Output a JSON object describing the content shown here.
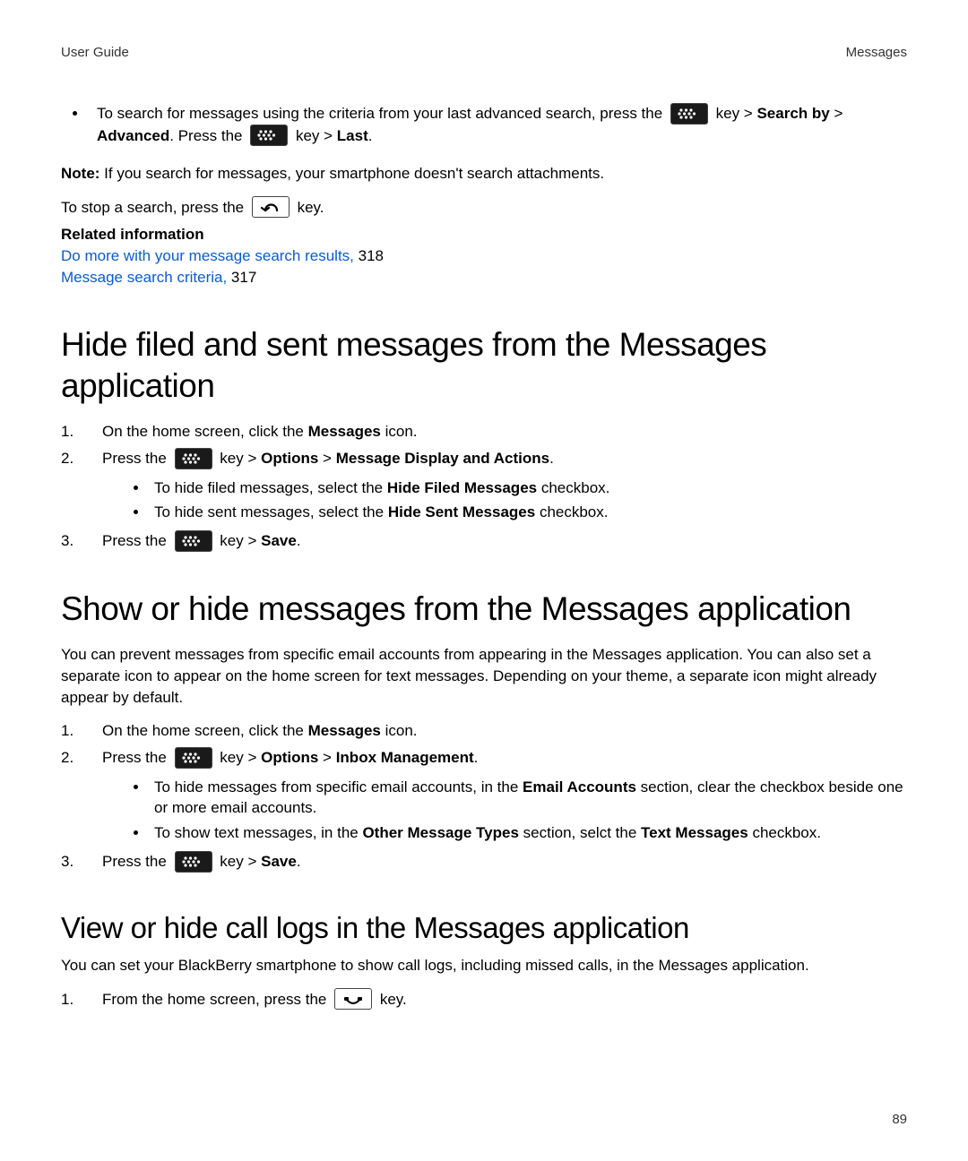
{
  "header": {
    "left": "User Guide",
    "right": "Messages"
  },
  "top_bullet": {
    "t1": "To search for messages using the criteria from your last advanced search, press the ",
    "t2": " key > ",
    "t3": "Search by",
    "t4": " > ",
    "t5": "Advanced",
    "t6": ". Press the ",
    "t7": " key > ",
    "t8": "Last",
    "t9": "."
  },
  "note": {
    "label": "Note:",
    "text": " If you search for messages, your smartphone doesn't search attachments."
  },
  "stop_line": {
    "t1": "To stop a search, press the ",
    "t2": " key."
  },
  "related": {
    "heading": "Related information",
    "items": [
      {
        "link": "Do more with your message search results,",
        "page": " 318"
      },
      {
        "link": "Message search criteria,",
        "page": " 317"
      }
    ]
  },
  "section_a": {
    "title": "Hide filed and sent messages from the Messages application",
    "step1": {
      "t1": "On the home screen, click the ",
      "t2": "Messages",
      "t3": " icon."
    },
    "step2": {
      "t1": "Press the ",
      "t2": " key > ",
      "t3": "Options",
      "t4": " > ",
      "t5": "Message Display and Actions",
      "t6": "."
    },
    "sub1": {
      "t1": "To hide filed messages, select the ",
      "t2": "Hide Filed Messages",
      "t3": " checkbox."
    },
    "sub2": {
      "t1": "To hide sent messages, select the ",
      "t2": "Hide Sent Messages",
      "t3": " checkbox."
    },
    "step3": {
      "t1": "Press the ",
      "t2": " key > ",
      "t3": "Save",
      "t4": "."
    }
  },
  "section_b": {
    "title": "Show or hide messages from the Messages application",
    "intro": "You can prevent messages from specific email accounts from appearing in the Messages application. You can also set a separate icon to appear on the home screen for text messages. Depending on your theme, a separate icon might already appear by default.",
    "step1": {
      "t1": "On the home screen, click the ",
      "t2": "Messages",
      "t3": " icon."
    },
    "step2": {
      "t1": "Press the ",
      "t2": " key > ",
      "t3": "Options",
      "t4": " > ",
      "t5": "Inbox Management",
      "t6": "."
    },
    "sub1": {
      "t1": "To hide messages from specific email accounts, in the ",
      "t2": "Email Accounts",
      "t3": " section, clear the checkbox beside one or more email accounts."
    },
    "sub2": {
      "t1": "To show text messages, in the ",
      "t2": "Other Message Types",
      "t3": " section, selct the ",
      "t4": "Text Messages",
      "t5": " checkbox."
    },
    "step3": {
      "t1": "Press the ",
      "t2": " key > ",
      "t3": "Save",
      "t4": "."
    }
  },
  "section_c": {
    "title": "View or hide call logs in the Messages application",
    "intro": "You can set your BlackBerry smartphone to show call logs, including missed calls, in the Messages application.",
    "step1": {
      "t1": "From the home screen, press the ",
      "t2": " key."
    }
  },
  "page_number": "89"
}
